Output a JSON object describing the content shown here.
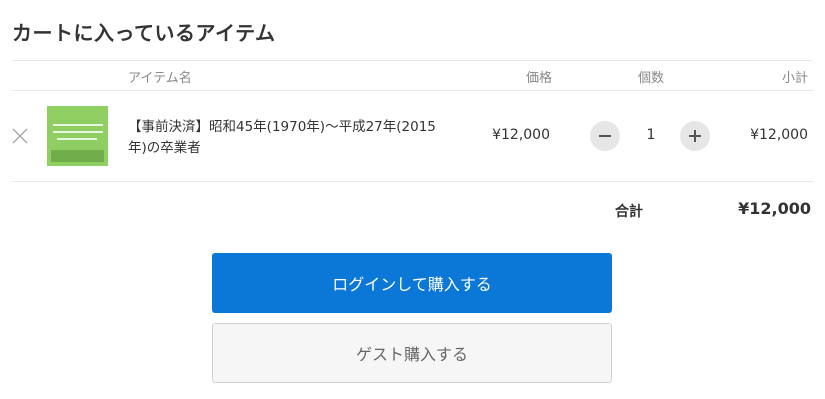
{
  "page": {
    "title": "カートに入っているアイテム"
  },
  "table": {
    "headers": {
      "item": "アイテム名",
      "price": "価格",
      "quantity": "個数",
      "subtotal": "小計"
    },
    "rows": [
      {
        "name": "【事前決済】昭和45年(1970年)～平成27年(2015年)の卒業者",
        "price": "¥12,000",
        "quantity": "1",
        "subtotal": "¥12,000",
        "thumbnail_color": "#8fcf62"
      }
    ]
  },
  "total": {
    "label": "合計",
    "value": "¥12,000"
  },
  "buttons": {
    "login_purchase": "ログインして購入する",
    "guest_purchase": "ゲスト購入する"
  },
  "colors": {
    "primary": "#0b78d7",
    "text": "#333333",
    "muted": "#888888",
    "divider": "#e8e8e8"
  }
}
